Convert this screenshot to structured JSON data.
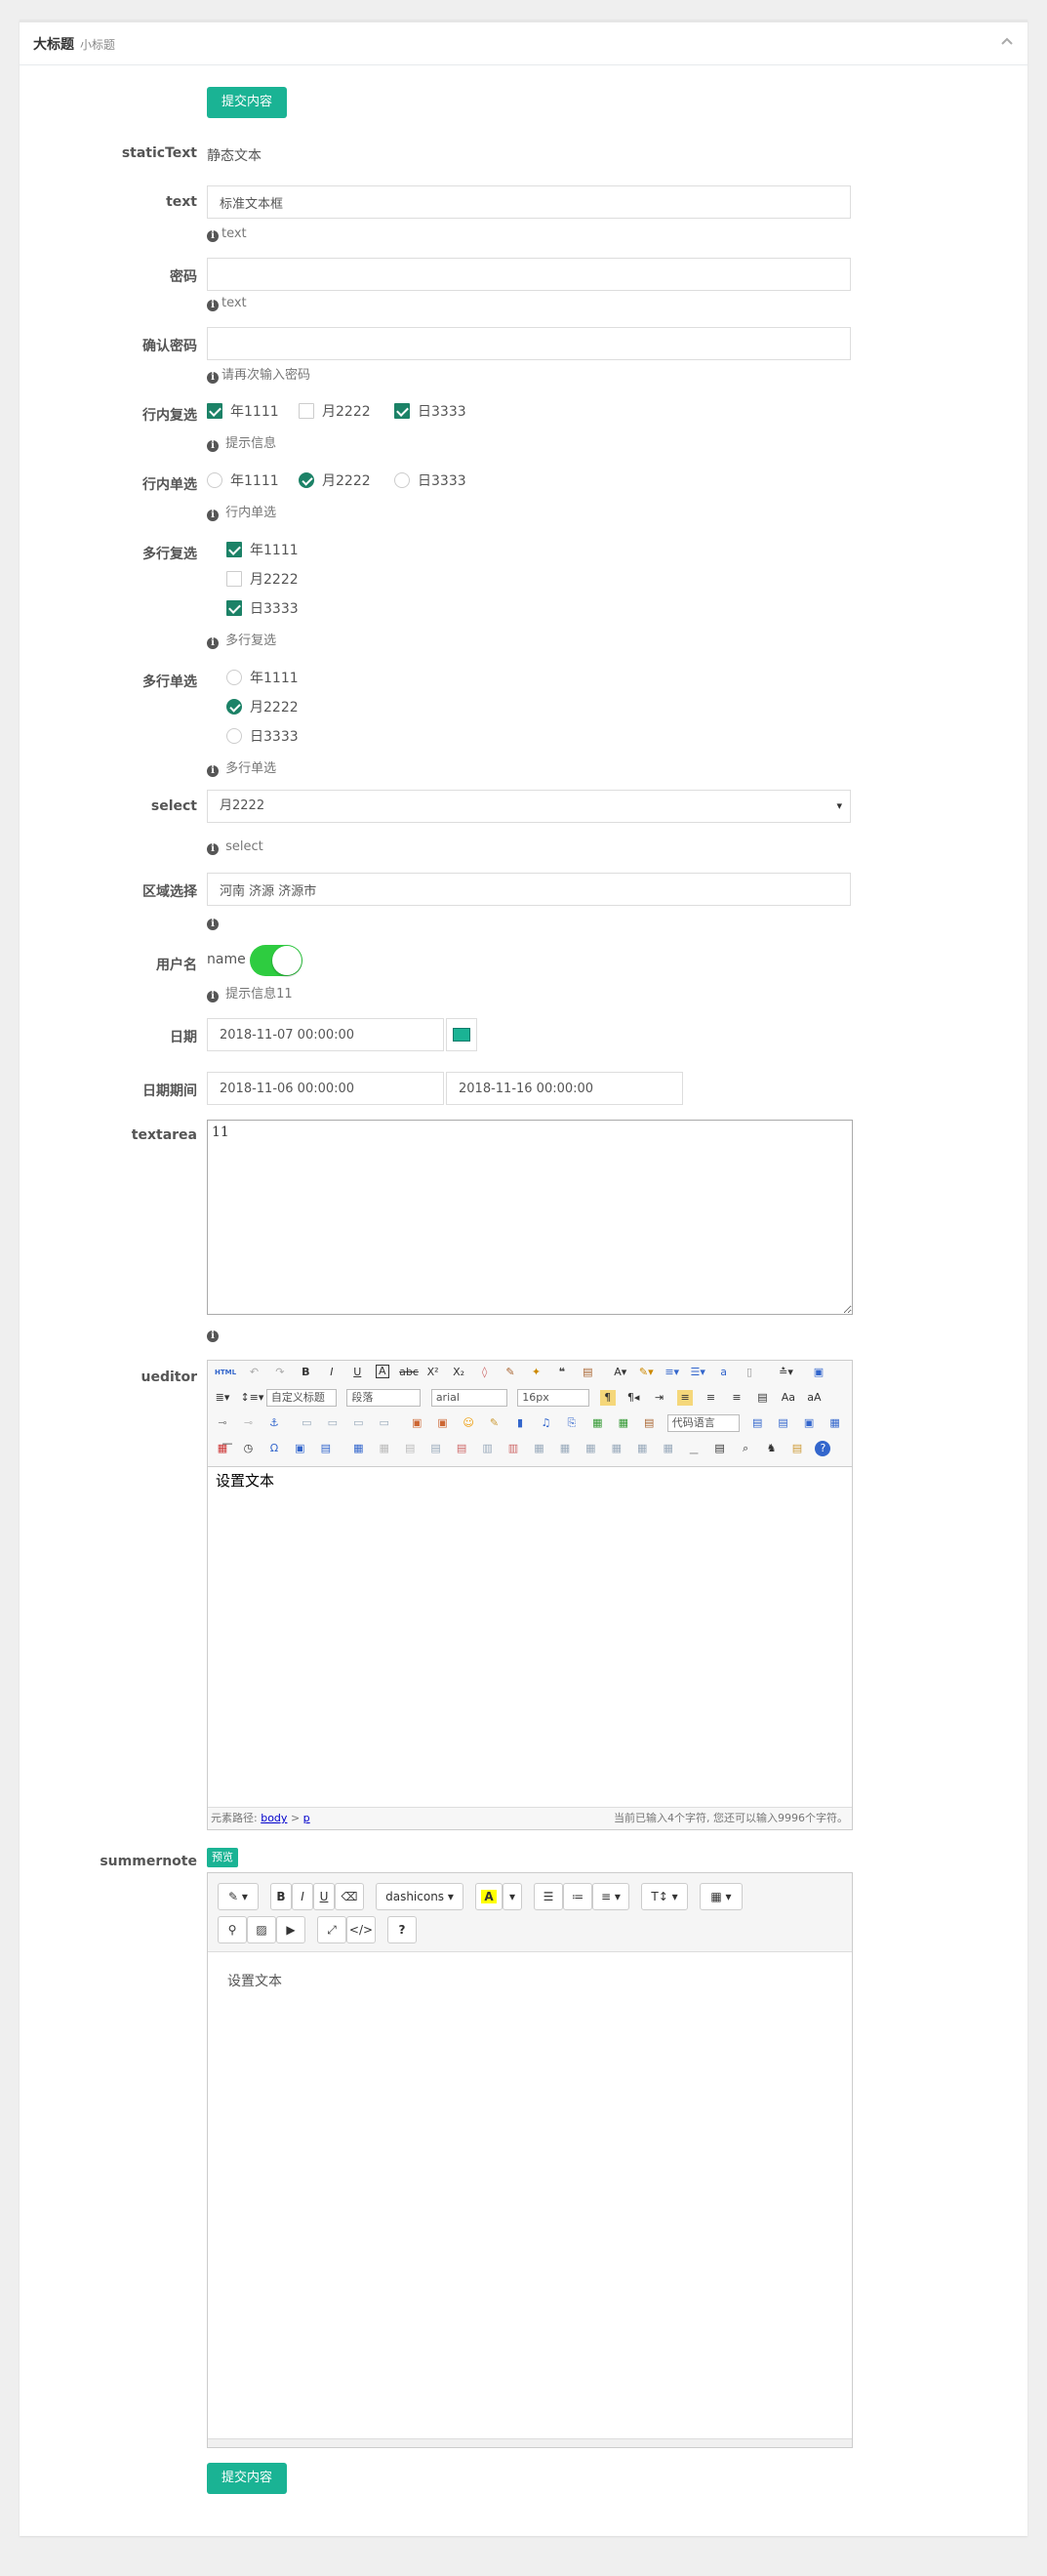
{
  "panel": {
    "title": "大标题",
    "subtitle": "小标题",
    "collapse_icon": "chevron-up-icon"
  },
  "submit_label": "提交内容",
  "static_text": {
    "label": "staticText",
    "value": "静态文本"
  },
  "text": {
    "label": "text",
    "value": "标准文本框",
    "help": "text"
  },
  "password": {
    "label": "密码",
    "value": "",
    "help": "text"
  },
  "confirm_password": {
    "label": "确认密码",
    "value": "",
    "help": "请再次输入密码"
  },
  "inline_checkbox": {
    "label": "行内复选",
    "options": [
      {
        "text": "年1111",
        "checked": true
      },
      {
        "text": "月2222",
        "checked": false
      },
      {
        "text": "日3333",
        "checked": true
      }
    ],
    "help": "提示信息"
  },
  "inline_radio": {
    "label": "行内单选",
    "options": [
      {
        "text": "年1111",
        "checked": false
      },
      {
        "text": "月2222",
        "checked": true
      },
      {
        "text": "日3333",
        "checked": false
      }
    ],
    "help": "行内单选"
  },
  "multi_checkbox": {
    "label": "多行复选",
    "options": [
      {
        "text": "年1111",
        "checked": true
      },
      {
        "text": "月2222",
        "checked": false
      },
      {
        "text": "日3333",
        "checked": true
      }
    ],
    "help": "多行复选"
  },
  "multi_radio": {
    "label": "多行单选",
    "options": [
      {
        "text": "年1111",
        "checked": false
      },
      {
        "text": "月2222",
        "checked": true
      },
      {
        "text": "日3333",
        "checked": false
      }
    ],
    "help": "多行单选"
  },
  "select": {
    "label": "select",
    "value": "月2222",
    "help": "select",
    "arrow": "▾"
  },
  "region": {
    "label": "区域选择",
    "value": "河南 济源 济源市",
    "help": ""
  },
  "username": {
    "label": "用户名",
    "switch_label": "name",
    "on": true,
    "help": "提示信息11"
  },
  "date": {
    "label": "日期",
    "value": "2018-11-07 00:00:00"
  },
  "date_range": {
    "label": "日期期间",
    "start": "2018-11-06 00:00:00",
    "end": "2018-11-16 00:00:00"
  },
  "textarea": {
    "label": "textarea",
    "value": "11",
    "help": ""
  },
  "ueditor": {
    "label": "ueditor",
    "content": "设置文本",
    "font_family_select": "自定义标题",
    "paragraph_select": "段落",
    "font_select": "arial",
    "size_select": "16px",
    "code_select": "代码语言",
    "footer_path_label": "元素路径:",
    "footer_path_body": "body",
    "footer_path_sep": ">",
    "footer_path_p": "p",
    "footer_count": "当前已输入4个字符, 您还可以输入9996个字符。",
    "html_label": "HTML"
  },
  "summernote": {
    "label": "summernote",
    "preview_label": "预览",
    "content": "设置文本",
    "font_name": "dashicons",
    "bold": "B",
    "italic": "I",
    "underline": "U",
    "help_btn": "?"
  }
}
